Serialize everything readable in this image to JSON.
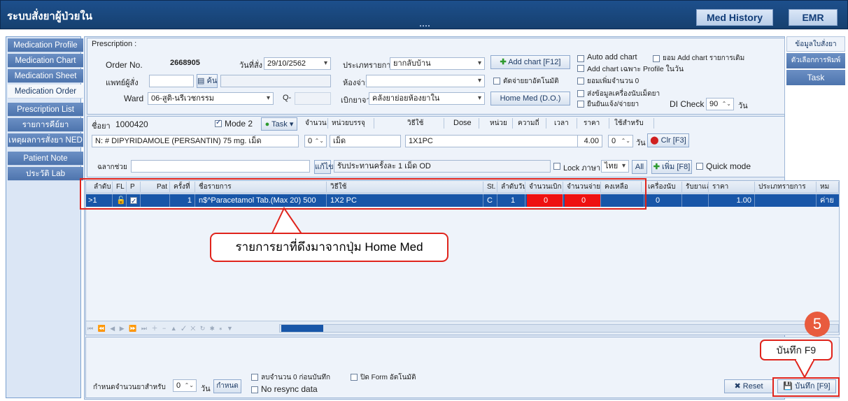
{
  "app_title": "ระบบสั่งยาผู้ป่วยใน",
  "header_buttons": {
    "med_history": "Med History",
    "emr": "EMR"
  },
  "left_nav": [
    "Medication Profile",
    "Medication Chart",
    "Medication Sheet",
    "Medication Order",
    "Prescription List",
    "รายการคีย์ยา",
    "เหตุผลการสั่งยา NED",
    "Patient Note",
    "ประวัติ Lab"
  ],
  "left_nav_active": "Medication Order",
  "right_nav": [
    "ข้อมูลใบสั่งยา",
    "ตัวเลือกการพิมพ์",
    "Task"
  ],
  "prescription": {
    "section_label": "Prescription :",
    "order_no_label": "Order No.",
    "order_no": "2668905",
    "order_date_label": "วันที่สั่ง",
    "order_date": "29/10/2562",
    "category_label": "ประเภทรายการ",
    "category_value": "ยากลับบ้าน",
    "doctor_label": "แพทย์ผู้สั่ง",
    "search_btn": "ค้น",
    "room_label": "ห้องจ่าย",
    "ward_label": "Ward",
    "ward_value": "06-สูติ-นรีเวชกรรม",
    "q_label": "Q-",
    "withdraw_label": "เบิกยาจาก",
    "withdraw_value": "คลังยาย่อยห้องยาใน",
    "add_chart_btn": "Add chart [F12]",
    "cut_auto_label": "ตัดจ่ายยาอัตโนมัติ",
    "home_med_btn": "Home Med (D.O.)",
    "opt_auto_add": "Auto add chart",
    "opt_allow_add": "ยอม Add chart รายการเดิม",
    "opt_profile_day": "Add chart เฉพาะ Profile ในวัน",
    "opt_allow_zero": "ยอมเพิ่มจำนวน 0",
    "opt_send_dispenser": "ส่งข้อมูลเครื่องนับเม็ดยา",
    "opt_confirm": "ยืนยันแจ้ง/จ่ายยา",
    "di_check_label": "DI Check",
    "di_check_value": "90",
    "day_unit": "วัน"
  },
  "drug_entry": {
    "drug_label": "ชื่อยา",
    "drug_code": "1000420",
    "mode2_label": "Mode 2",
    "task_btn": "Task",
    "drug_name": "N: # DIPYRIDAMOLE (PERSANTIN) 75 mg. เม็ด",
    "cols": [
      "จำนวน",
      "หน่วยบรรจุ",
      "วิธีใช้",
      "Dose",
      "หน่วย",
      "ความถี่",
      "เวลา",
      "ราคา",
      "ใช้สำหรับ"
    ],
    "qty": "0",
    "pack_unit": "เม็ด",
    "usage": "1X1PC",
    "price": "4.00",
    "use_for": "0",
    "use_for_unit": "วัน",
    "clr_btn": "Clr [F3]",
    "aux_label": "ฉลากช่วย",
    "edit_btn": "แก้ไข",
    "usage_text": "รับประทานครั้งละ 1 เม็ด OD",
    "lock_label": "Lock ภาษา",
    "language": "ไทย",
    "all_btn": "All",
    "add_btn": "เพิ่ม [F8]",
    "quick_mode_label": "Quick mode"
  },
  "grid": {
    "headers": [
      "ลำดับ",
      "FL",
      "P",
      "Pat",
      "ครั้งที่",
      "ชื่อรายการ",
      "วิธีใช้",
      "St.",
      "ลำดับวัน",
      "จำนวนเบิก",
      "จำนวนจ่าย",
      "คงเหลือ",
      "เครื่องนับ",
      "รับยาแล้ว",
      "ราคา",
      "ประเภทรายการ",
      "หม"
    ],
    "row": {
      "seq": "1",
      "times": "1",
      "name": "n$^Paracetamol Tab.(Max 20) 500",
      "usage": "1X2 PC",
      "status": "C",
      "day_seq": "1",
      "withdraw_qty": "0",
      "dispense_qty": "0",
      "counter": "0",
      "price": "1.00",
      "category": "ค่าย"
    }
  },
  "annotation_text": "รายการยาที่ดึงมาจากปุ่ม Home Med",
  "step_badge": "5",
  "save_callout": "บันทึก F9",
  "bottom": {
    "set_qty_label": "กำหนดจำนวนยาสำหรับ",
    "set_qty_value": "0",
    "day_unit": "วัน",
    "set_btn": "กำหนด",
    "opt_remove_zero": "ลบจำนวน 0 ก่อนบันทึก",
    "opt_no_resync": "No resync data",
    "opt_close_form": "ปิด Form อัตโนมัติ",
    "reset_btn": "Reset",
    "save_btn": "บันทึก [F9]"
  }
}
